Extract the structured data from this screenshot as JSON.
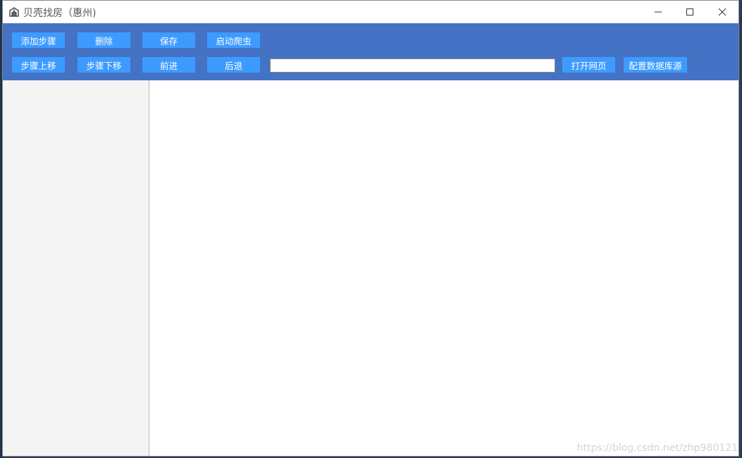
{
  "window": {
    "title": "贝壳找房（惠州)"
  },
  "toolbar": {
    "row1": [
      {
        "label": "添加步骤",
        "name": "add-step-button"
      },
      {
        "label": "删除",
        "name": "delete-button"
      },
      {
        "label": "保存",
        "name": "save-button"
      },
      {
        "label": "启动爬虫",
        "name": "start-crawler-button"
      }
    ],
    "row2": [
      {
        "label": "步骤上移",
        "name": "move-step-up-button"
      },
      {
        "label": "步骤下移",
        "name": "move-step-down-button"
      },
      {
        "label": "前进",
        "name": "forward-button"
      },
      {
        "label": "后退",
        "name": "back-button"
      }
    ],
    "url_value": "",
    "open_page_label": "打开网页",
    "db_config_label": "配置数据库源"
  },
  "watermark": "https://blog.csdn.net/zhp980121",
  "colors": {
    "toolbar_bg": "#4472c4",
    "button_bg": "#3d9bff",
    "left_panel_bg": "#f4f4f4"
  },
  "icons": [
    "app-icon",
    "minimize-icon",
    "maximize-icon",
    "close-icon"
  ]
}
